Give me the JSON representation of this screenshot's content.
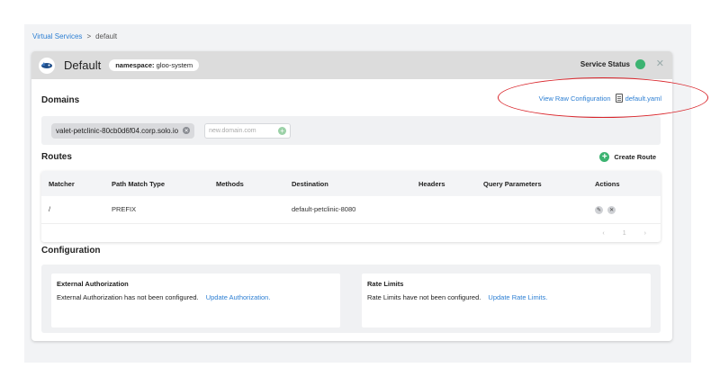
{
  "breadcrumb": {
    "root": "Virtual Services",
    "separator": ">",
    "current": "default"
  },
  "header": {
    "title": "Default",
    "namespace_label": "namespace:",
    "namespace_value": "gloo-system",
    "service_status_label": "Service Status",
    "close": "✕"
  },
  "domains": {
    "title": "Domains",
    "view_raw_label": "View Raw Configuration",
    "raw_file": "default.yaml",
    "chips": [
      "valet-petclinic-80cb0d6f04.corp.solo.io"
    ],
    "input_placeholder": "new.domain.com"
  },
  "routes": {
    "title": "Routes",
    "create_label": "Create Route",
    "columns": [
      "Matcher",
      "Path Match Type",
      "Methods",
      "Destination",
      "Headers",
      "Query Parameters",
      "Actions"
    ],
    "rows": [
      {
        "matcher": "/",
        "path_match_type": "PREFIX",
        "methods": "",
        "destination": "default-petclinic-8080",
        "headers": "",
        "query_parameters": ""
      }
    ],
    "pager": {
      "prev": "‹",
      "page": "1",
      "next": "›"
    }
  },
  "configuration": {
    "title": "Configuration",
    "ext_auth": {
      "title": "External Authorization",
      "text": "External Authorization has not been configured.",
      "link": "Update Authorization."
    },
    "rate_limits": {
      "title": "Rate Limits",
      "text": "Rate Limits have not been configured.",
      "link": "Update Rate Limits."
    }
  },
  "colors": {
    "accent": "#2d7fd3",
    "status_ok": "#3cb371",
    "annotation": "#d9242a"
  }
}
